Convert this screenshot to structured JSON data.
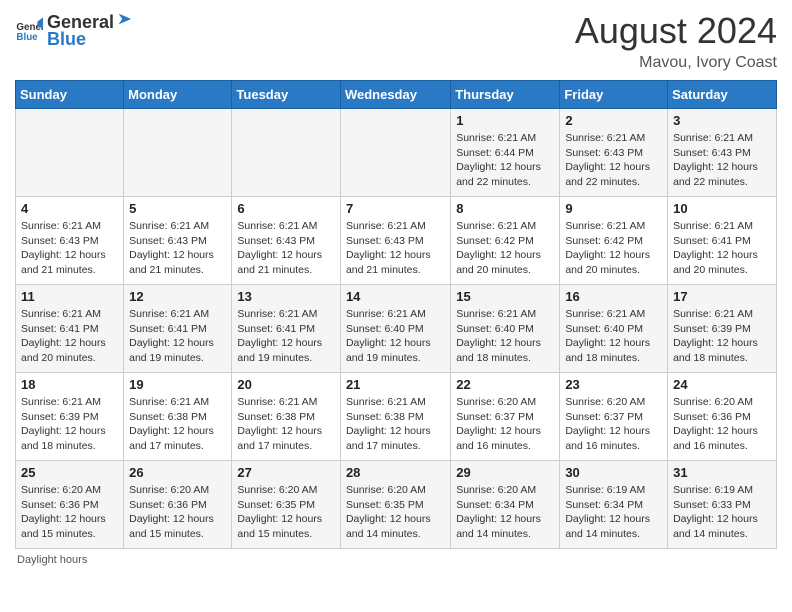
{
  "header": {
    "logo_general": "General",
    "logo_blue": "Blue",
    "title": "August 2024",
    "location": "Mavou, Ivory Coast"
  },
  "footer": {
    "note": "Daylight hours"
  },
  "days_of_week": [
    "Sunday",
    "Monday",
    "Tuesday",
    "Wednesday",
    "Thursday",
    "Friday",
    "Saturday"
  ],
  "weeks": [
    [
      {
        "day": "",
        "info": ""
      },
      {
        "day": "",
        "info": ""
      },
      {
        "day": "",
        "info": ""
      },
      {
        "day": "",
        "info": ""
      },
      {
        "day": "1",
        "info": "Sunrise: 6:21 AM\nSunset: 6:44 PM\nDaylight: 12 hours\nand 22 minutes."
      },
      {
        "day": "2",
        "info": "Sunrise: 6:21 AM\nSunset: 6:43 PM\nDaylight: 12 hours\nand 22 minutes."
      },
      {
        "day": "3",
        "info": "Sunrise: 6:21 AM\nSunset: 6:43 PM\nDaylight: 12 hours\nand 22 minutes."
      }
    ],
    [
      {
        "day": "4",
        "info": "Sunrise: 6:21 AM\nSunset: 6:43 PM\nDaylight: 12 hours\nand 21 minutes."
      },
      {
        "day": "5",
        "info": "Sunrise: 6:21 AM\nSunset: 6:43 PM\nDaylight: 12 hours\nand 21 minutes."
      },
      {
        "day": "6",
        "info": "Sunrise: 6:21 AM\nSunset: 6:43 PM\nDaylight: 12 hours\nand 21 minutes."
      },
      {
        "day": "7",
        "info": "Sunrise: 6:21 AM\nSunset: 6:43 PM\nDaylight: 12 hours\nand 21 minutes."
      },
      {
        "day": "8",
        "info": "Sunrise: 6:21 AM\nSunset: 6:42 PM\nDaylight: 12 hours\nand 20 minutes."
      },
      {
        "day": "9",
        "info": "Sunrise: 6:21 AM\nSunset: 6:42 PM\nDaylight: 12 hours\nand 20 minutes."
      },
      {
        "day": "10",
        "info": "Sunrise: 6:21 AM\nSunset: 6:41 PM\nDaylight: 12 hours\nand 20 minutes."
      }
    ],
    [
      {
        "day": "11",
        "info": "Sunrise: 6:21 AM\nSunset: 6:41 PM\nDaylight: 12 hours\nand 20 minutes."
      },
      {
        "day": "12",
        "info": "Sunrise: 6:21 AM\nSunset: 6:41 PM\nDaylight: 12 hours\nand 19 minutes."
      },
      {
        "day": "13",
        "info": "Sunrise: 6:21 AM\nSunset: 6:41 PM\nDaylight: 12 hours\nand 19 minutes."
      },
      {
        "day": "14",
        "info": "Sunrise: 6:21 AM\nSunset: 6:40 PM\nDaylight: 12 hours\nand 19 minutes."
      },
      {
        "day": "15",
        "info": "Sunrise: 6:21 AM\nSunset: 6:40 PM\nDaylight: 12 hours\nand 18 minutes."
      },
      {
        "day": "16",
        "info": "Sunrise: 6:21 AM\nSunset: 6:40 PM\nDaylight: 12 hours\nand 18 minutes."
      },
      {
        "day": "17",
        "info": "Sunrise: 6:21 AM\nSunset: 6:39 PM\nDaylight: 12 hours\nand 18 minutes."
      }
    ],
    [
      {
        "day": "18",
        "info": "Sunrise: 6:21 AM\nSunset: 6:39 PM\nDaylight: 12 hours\nand 18 minutes."
      },
      {
        "day": "19",
        "info": "Sunrise: 6:21 AM\nSunset: 6:38 PM\nDaylight: 12 hours\nand 17 minutes."
      },
      {
        "day": "20",
        "info": "Sunrise: 6:21 AM\nSunset: 6:38 PM\nDaylight: 12 hours\nand 17 minutes."
      },
      {
        "day": "21",
        "info": "Sunrise: 6:21 AM\nSunset: 6:38 PM\nDaylight: 12 hours\nand 17 minutes."
      },
      {
        "day": "22",
        "info": "Sunrise: 6:20 AM\nSunset: 6:37 PM\nDaylight: 12 hours\nand 16 minutes."
      },
      {
        "day": "23",
        "info": "Sunrise: 6:20 AM\nSunset: 6:37 PM\nDaylight: 12 hours\nand 16 minutes."
      },
      {
        "day": "24",
        "info": "Sunrise: 6:20 AM\nSunset: 6:36 PM\nDaylight: 12 hours\nand 16 minutes."
      }
    ],
    [
      {
        "day": "25",
        "info": "Sunrise: 6:20 AM\nSunset: 6:36 PM\nDaylight: 12 hours\nand 15 minutes."
      },
      {
        "day": "26",
        "info": "Sunrise: 6:20 AM\nSunset: 6:36 PM\nDaylight: 12 hours\nand 15 minutes."
      },
      {
        "day": "27",
        "info": "Sunrise: 6:20 AM\nSunset: 6:35 PM\nDaylight: 12 hours\nand 15 minutes."
      },
      {
        "day": "28",
        "info": "Sunrise: 6:20 AM\nSunset: 6:35 PM\nDaylight: 12 hours\nand 14 minutes."
      },
      {
        "day": "29",
        "info": "Sunrise: 6:20 AM\nSunset: 6:34 PM\nDaylight: 12 hours\nand 14 minutes."
      },
      {
        "day": "30",
        "info": "Sunrise: 6:19 AM\nSunset: 6:34 PM\nDaylight: 12 hours\nand 14 minutes."
      },
      {
        "day": "31",
        "info": "Sunrise: 6:19 AM\nSunset: 6:33 PM\nDaylight: 12 hours\nand 14 minutes."
      }
    ]
  ]
}
